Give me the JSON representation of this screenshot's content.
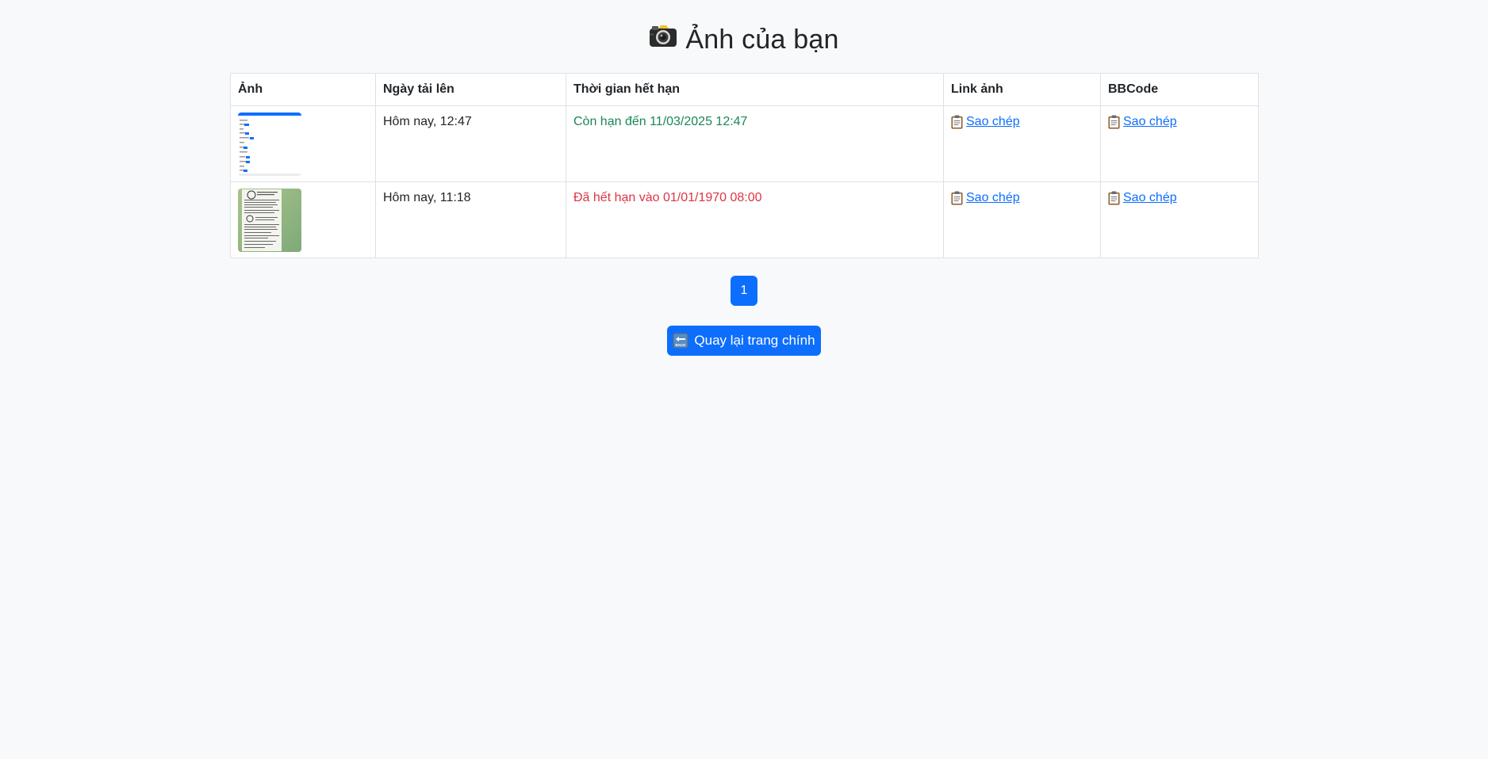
{
  "page": {
    "title": "Ảnh của bạn",
    "title_icon": "camera-icon"
  },
  "table": {
    "headers": [
      "Ảnh",
      "Ngày tải lên",
      "Thời gian hết hạn",
      "Link ảnh",
      "BBCode"
    ],
    "rows": [
      {
        "thumbnail": "screenshot-thumbnail",
        "uploaded": "Hôm nay, 12:47",
        "expiry": "Còn hạn đến 11/03/2025 12:47",
        "expiry_status": "valid",
        "link_label": "Sao chép",
        "bbcode_label": "Sao chép"
      },
      {
        "thumbnail": "document-thumbnail",
        "uploaded": "Hôm nay, 11:18",
        "expiry": "Đã hết hạn vào 01/01/1970 08:00",
        "expiry_status": "expired",
        "link_label": "Sao chép",
        "bbcode_label": "Sao chép"
      }
    ]
  },
  "pagination": {
    "current": "1"
  },
  "back_button": {
    "label": "Quay lại trang chính",
    "icon": "back-arrow-icon"
  },
  "colors": {
    "primary": "#0d6efd",
    "valid": "#198754",
    "expired": "#dc3545",
    "background": "#f8f9fa"
  }
}
